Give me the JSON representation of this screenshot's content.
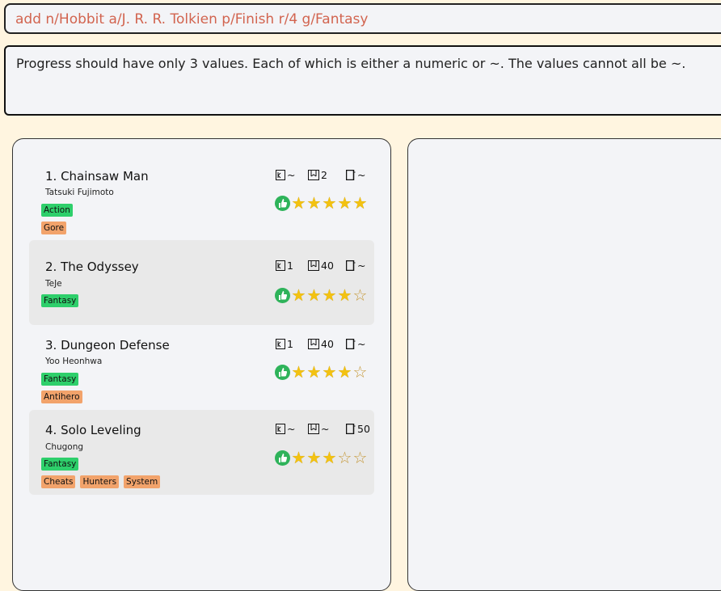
{
  "command": {
    "value": "add n/Hobbit a/J. R. R. Tolkien p/Finish r/4 g/Fantasy"
  },
  "result": {
    "message": "Progress should have only 3 values. Each of which is either a numeric or ~. The values cannot all be ~."
  },
  "books": [
    {
      "index_title": "1. Chainsaw Man",
      "author": "Tatsuki Fujimoto",
      "progress": {
        "volume": "~",
        "chapter": "2",
        "page": "~"
      },
      "rating": 5,
      "max_rating": 5,
      "genre": "Action",
      "tags": [
        "Gore"
      ]
    },
    {
      "index_title": "2. The Odyssey",
      "author": "TeJe",
      "progress": {
        "volume": "1",
        "chapter": "40",
        "page": "~"
      },
      "rating": 4,
      "max_rating": 5,
      "genre": "Fantasy",
      "tags": []
    },
    {
      "index_title": "3. Dungeon Defense",
      "author": "Yoo Heonhwa",
      "progress": {
        "volume": "1",
        "chapter": "40",
        "page": "~"
      },
      "rating": 4,
      "max_rating": 5,
      "genre": "Fantasy",
      "tags": [
        "Antihero"
      ]
    },
    {
      "index_title": "4. Solo Leveling",
      "author": "Chugong",
      "progress": {
        "volume": "~",
        "chapter": "~",
        "page": "50"
      },
      "rating": 3,
      "max_rating": 5,
      "genre": "Fantasy",
      "tags": [
        "Cheats",
        "Hunters",
        "System"
      ]
    }
  ],
  "colors": {
    "genre_tag": "#2ecf6b",
    "other_tag": "#f2a36b",
    "command_text": "#d2644f",
    "star": "#f3c211",
    "like_badge": "#2eb35a"
  },
  "icons": {
    "volume": "volume-icon",
    "chapter": "chapter-icon",
    "page": "page-icon",
    "like": "thumbs-up-icon",
    "star": "star-icon"
  }
}
